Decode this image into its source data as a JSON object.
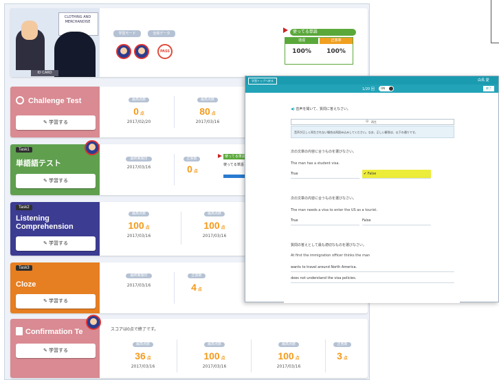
{
  "header": {
    "speech_bubble": "CLOTHING AND MERCHANDISE",
    "name_strip": "ID CARD",
    "pill_1": "学習モード",
    "pill_2": "全体データ",
    "badge_pass": "PASS",
    "progress_label": "使ってる単語",
    "progress_tag": "",
    "progress_col1": "達成",
    "progress_col2": "正答率",
    "progress_val1": "100%",
    "progress_val2": "100%"
  },
  "cards": [
    {
      "title": "Challenge Test",
      "task_tag": "",
      "button": "✎ 学習する",
      "color": "#d98a92",
      "scores": [
        {
          "label": "最高点数",
          "value": "0",
          "unit": "点",
          "date": "2017/02/20"
        },
        {
          "label": "最高点数",
          "value": "80",
          "unit": "点",
          "date": "2017/03/16"
        }
      ]
    },
    {
      "title": "単語語テスト",
      "task_tag": "Task1",
      "button": "✎ 学習する",
      "color": "#5f9f4e",
      "scores": [
        {
          "label": "最終実施日",
          "value": "",
          "unit": "",
          "date": "2017/03/16"
        },
        {
          "label": "正答数",
          "value": "0",
          "unit": "点",
          "date": ""
        }
      ],
      "side_label": "使ってる単語",
      "side_label_2": "使ってる単語"
    },
    {
      "title": "Listening Comprehension",
      "task_tag": "Task2",
      "button": "✎ 学習する",
      "color": "#3c3c92",
      "scores": [
        {
          "label": "最高点数",
          "value": "100",
          "unit": "点",
          "date": "2017/03/16"
        },
        {
          "label": "最高点数",
          "value": "100",
          "unit": "点",
          "date": "2017/03/16"
        }
      ]
    },
    {
      "title": "Cloze",
      "task_tag": "Task3",
      "button": "✎ 学習する",
      "color": "#e67e22",
      "scores": [
        {
          "label": "最終実施日",
          "value": "",
          "unit": "",
          "date": "2017/03/16"
        },
        {
          "label": "正答数",
          "value": "4",
          "unit": "点",
          "date": ""
        }
      ]
    },
    {
      "title": "Confirmation Te",
      "task_tag": "",
      "button": "✎ 学習する",
      "color": "#d98a92",
      "note": "スコアは0点で終了です。",
      "scores": [
        {
          "label": "最高点数",
          "value": "36",
          "unit": "点",
          "date": "2017/03/16"
        },
        {
          "label": "最高点数",
          "value": "100",
          "unit": "点",
          "date": "2017/03/16"
        },
        {
          "label": "最高点数",
          "value": "100",
          "unit": "点",
          "date": "2017/03/16"
        },
        {
          "label": "正答数",
          "value": "3",
          "unit": "点",
          "date": ""
        }
      ]
    }
  ],
  "exercise": {
    "back_button": "学習トップへ戻る",
    "user_label": "白鳥 愛",
    "header_label": "1/20 回",
    "toggle_label": "ON",
    "header_btn": "終了",
    "instruction": "音声を聞いて、質問に答えなさい。",
    "play_label": "再生",
    "notice": "音声が正しく再生されない場合は再読み込みしてください。なお、正しい解答は、以下の通りです。",
    "q1": "次の文章の内容に合うものを選びなさい。",
    "q1_sentence": "The man has a student visa.",
    "q1_opt_true": "True",
    "q1_opt_false": "False",
    "q2": "次の文章の内容に合うものを選びなさい。",
    "q2_sentence": "The man needs a visa to enter the US as a tourist.",
    "q2_opt_true": "True",
    "q2_opt_false": "False",
    "q3": "質問の答えとして最も適切なものを選びなさい。",
    "q3_sentence": "At first the immigration officer thinks the man",
    "q3_choice_1": "wants to travel around North America.",
    "q3_choice_2": "does not understand the visa policies."
  },
  "colors": {
    "teal": "#1a9bb0",
    "orange_score": "#f39a1b",
    "highlight": "#ecec3a"
  }
}
